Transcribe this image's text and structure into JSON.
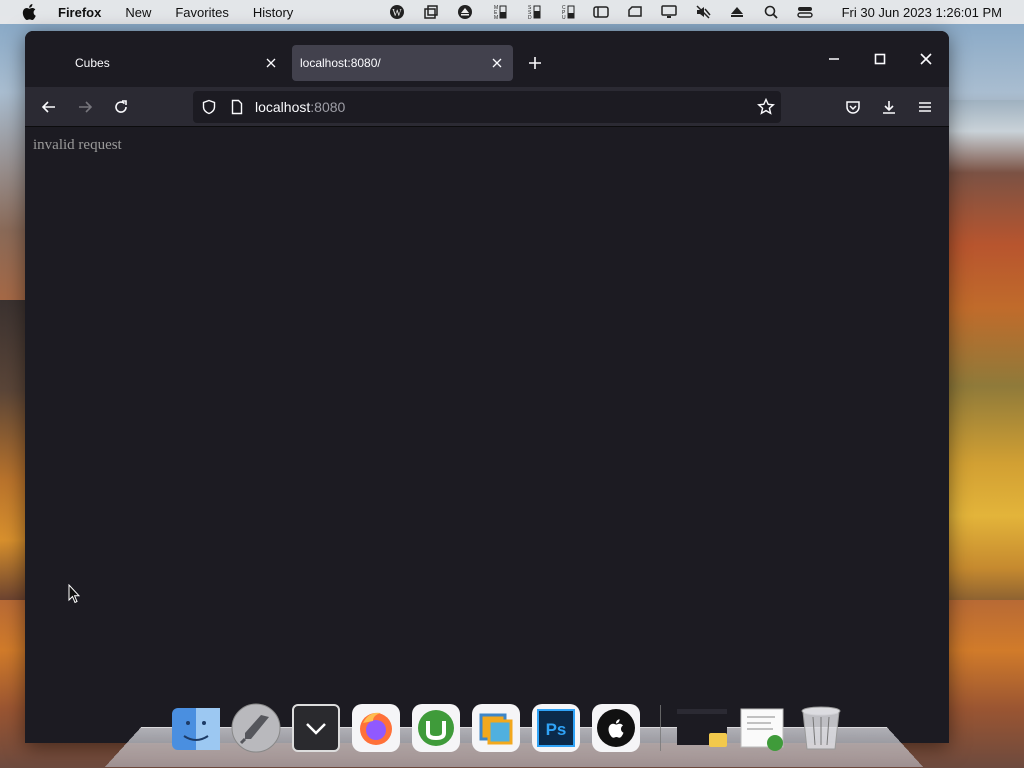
{
  "menubar": {
    "app_name": "Firefox",
    "items": [
      "New",
      "Favorites",
      "History"
    ],
    "clock": "Fri 30 Jun 2023  1:26:01 PM",
    "status_icons": [
      "wordpress-icon",
      "stack-icon",
      "eject-icon",
      "memory-meter-icon",
      "ssd-meter-icon",
      "cpu-meter-icon",
      "sidebar-icon",
      "drive-icon",
      "display-icon",
      "mute-icon",
      "eject-alt-icon",
      "search-icon",
      "control-center-icon"
    ]
  },
  "browser": {
    "tabs": [
      {
        "label": "Cubes",
        "active": false
      },
      {
        "label": "localhost:8080/",
        "active": true
      }
    ],
    "url": {
      "host": "localhost",
      "port": ":8080"
    },
    "content_message": "invalid request"
  },
  "dock": {
    "apps": [
      "Finder",
      "Launchpad",
      "Downloads",
      "Firefox",
      "uTorrent",
      "Parallels",
      "Photoshop",
      "Apple",
      "Window Preview",
      "Document Preview",
      "Trash"
    ]
  },
  "colors": {
    "window_bg": "#1c1b22",
    "toolbar_bg": "#2b2a33",
    "active_tab": "#42414d"
  }
}
